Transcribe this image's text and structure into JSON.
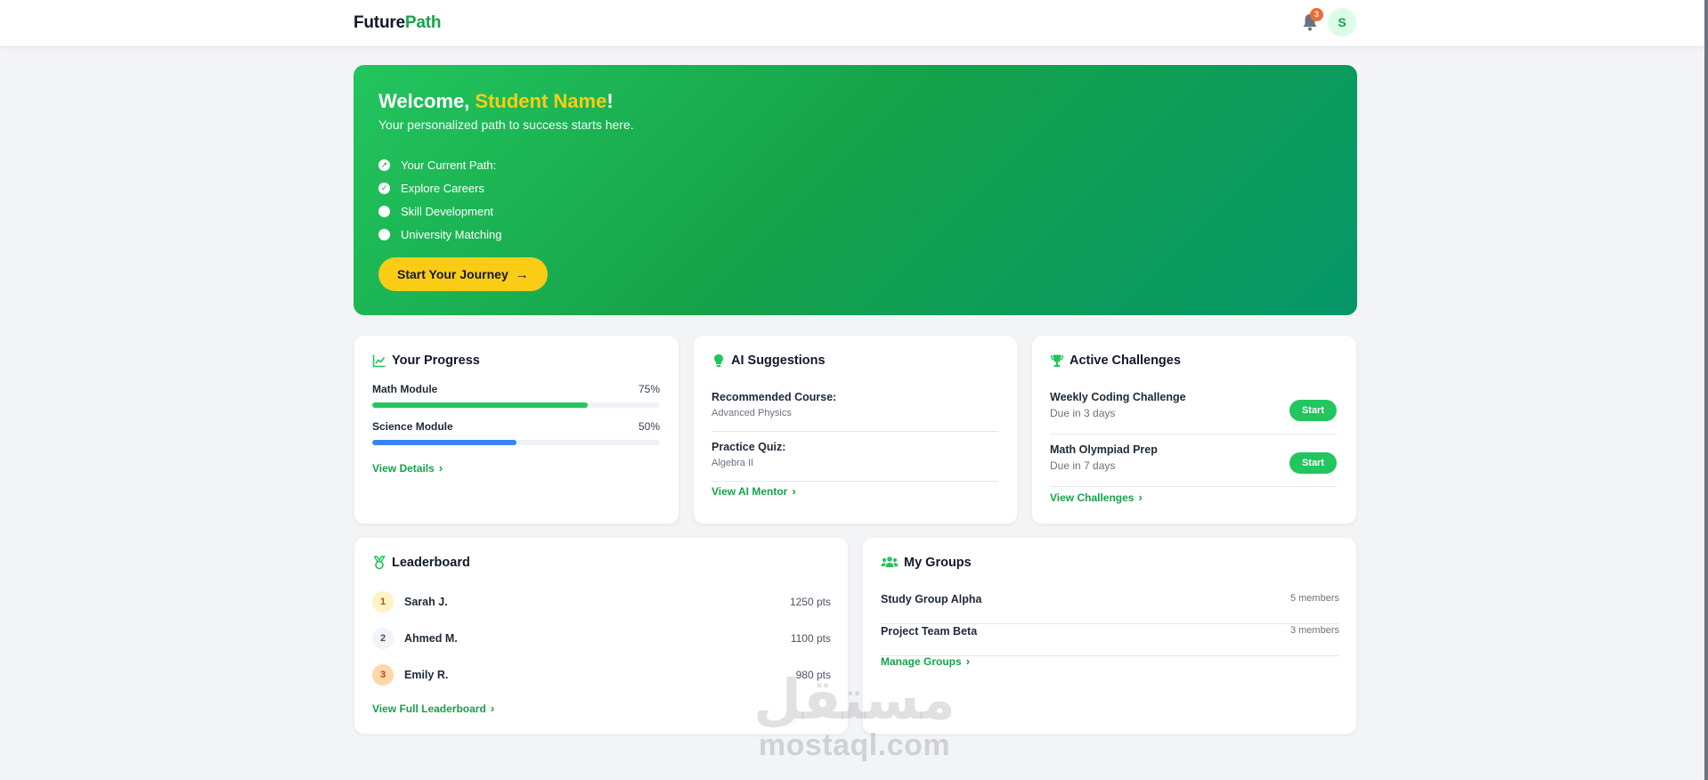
{
  "header": {
    "logo_part1": "Future",
    "logo_part2": "Path",
    "notification_count": "3",
    "avatar_initial": "S"
  },
  "hero": {
    "welcome_prefix": "Welcome, ",
    "student_name": "Student Name",
    "welcome_suffix": "!",
    "subtitle": "Your personalized path to success starts here.",
    "path_items": [
      {
        "label": "Your Current Path:",
        "icon": "compass-icon"
      },
      {
        "label": "Explore Careers",
        "icon": "check-circle-icon"
      },
      {
        "label": "Skill Development",
        "icon": "circle-icon"
      },
      {
        "label": "University Matching",
        "icon": "circle-icon"
      }
    ],
    "cta_label": "Start Your Journey",
    "colors": {
      "gradient_start": "#22c55e",
      "gradient_end": "#059669",
      "accent": "#facc15"
    }
  },
  "progress": {
    "title": "Your Progress",
    "icon": "chart-line-icon",
    "items": [
      {
        "label": "Math Module",
        "percent_text": "75%",
        "fraction": 0.75,
        "color": "#22c55e"
      },
      {
        "label": "Science Module",
        "percent_text": "50%",
        "fraction": 0.5,
        "color": "#3b82f6"
      }
    ],
    "link": "View Details"
  },
  "suggestions": {
    "title": "AI Suggestions",
    "icon": "lightbulb-icon",
    "items": [
      {
        "label": "Recommended Course:",
        "value": "Advanced Physics"
      },
      {
        "label": "Practice Quiz:",
        "value": "Algebra II"
      }
    ],
    "link": "View AI Mentor"
  },
  "challenges": {
    "title": "Active Challenges",
    "icon": "trophy-icon",
    "items": [
      {
        "label": "Weekly Coding Challenge",
        "due": "Due in 3 days",
        "button": "Start"
      },
      {
        "label": "Math Olympiad Prep",
        "due": "Due in 7 days",
        "button": "Start"
      }
    ],
    "link": "View Challenges"
  },
  "leaderboard": {
    "title": "Leaderboard",
    "icon": "medal-icon",
    "rows": [
      {
        "rank": "1",
        "name": "Sarah J.",
        "points": "1250 pts",
        "rank_bg": "#fef3c7",
        "rank_color": "#b45309"
      },
      {
        "rank": "2",
        "name": "Ahmed M.",
        "points": "1100 pts",
        "rank_bg": "#f1f5f9",
        "rank_color": "#475569"
      },
      {
        "rank": "3",
        "name": "Emily R.",
        "points": "980 pts",
        "rank_bg": "#fed7aa",
        "rank_color": "#c2410c"
      }
    ],
    "link": "View Full Leaderboard"
  },
  "groups": {
    "title": "My Groups",
    "icon": "users-icon",
    "rows": [
      {
        "name": "Study Group Alpha",
        "members": "5 members"
      },
      {
        "name": "Project Team Beta",
        "members": "3 members"
      }
    ],
    "link": "Manage Groups"
  },
  "watermark": {
    "arabic": "مستقل",
    "latin": "mostaql.com"
  }
}
